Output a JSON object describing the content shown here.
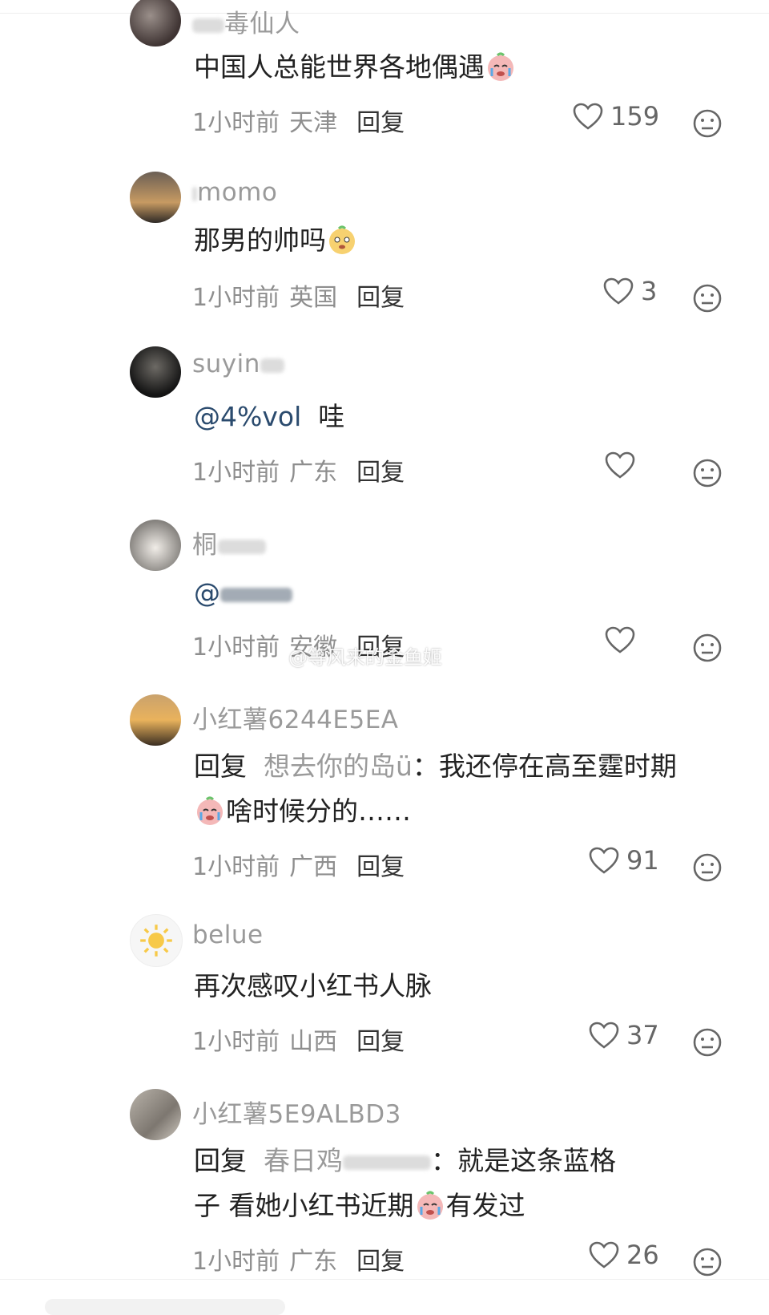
{
  "comments": [
    {
      "username": "毒仙人",
      "text": "中国人总能世界各地偶遇",
      "time": "1小时前",
      "location": "天津",
      "reply": "回复",
      "likes": "159"
    },
    {
      "username": "momo",
      "text": "那男的帅吗",
      "time": "1小时前",
      "location": "英国",
      "reply": "回复",
      "likes": "3"
    },
    {
      "username": "suyin",
      "mention": "@4%vol",
      "text": "哇",
      "time": "1小时前",
      "location": "广东",
      "reply": "回复",
      "likes": ""
    },
    {
      "username": "桐",
      "mention": "@",
      "text": "",
      "time": "1小时前",
      "location": "安徽",
      "reply": "回复",
      "likes": ""
    },
    {
      "username": "小红薯6244E5EA",
      "reply_prefix": "回复",
      "reply_target": "想去你的岛ü",
      "text_line1": "：我还停在高至霆时期",
      "text_line2": "啥时候分的……",
      "time": "1小时前",
      "location": "广西",
      "reply": "回复",
      "likes": "91"
    },
    {
      "username": "belue",
      "text": "再次感叹小红书人脉",
      "time": "1小时前",
      "location": "山西",
      "reply": "回复",
      "likes": "37"
    },
    {
      "username": "小红薯5E9ALBD3",
      "reply_prefix": "回复",
      "reply_target": "春日鸡",
      "text_line1": "：就是这条蓝格",
      "text_line2_a": "子 看她小红书近期",
      "text_line2_b": "有发过",
      "time": "1小时前",
      "location": "广东",
      "reply": "回复",
      "likes": "26"
    }
  ],
  "watermark": "@等风来的金鱼姬",
  "icons": {
    "heart": "heart-outline-icon",
    "face": "neutral-face-icon",
    "emoji": "crying-emoji-icon"
  }
}
